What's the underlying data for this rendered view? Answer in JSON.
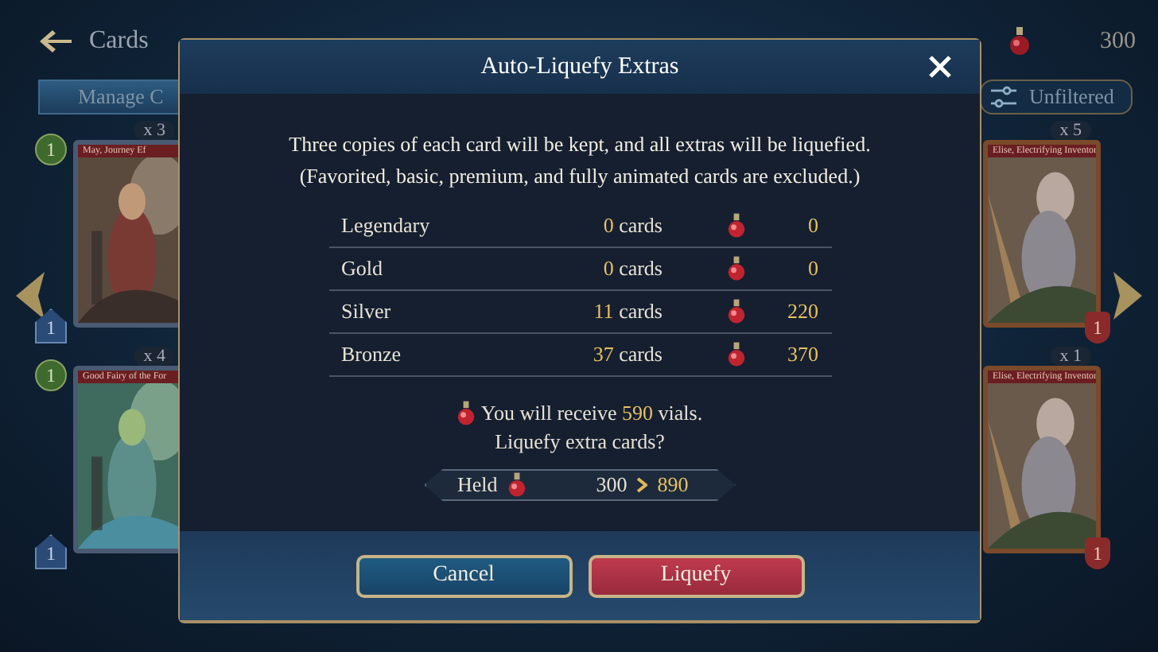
{
  "top_bar": {
    "title": "Cards",
    "vials": "300"
  },
  "manage_button": {
    "label": "Manage C"
  },
  "filter_button": {
    "label": "Unfiltered"
  },
  "left_cards": [
    {
      "count": "x 3",
      "title": "May, Journey Ef",
      "cost": "1",
      "gem": "1"
    },
    {
      "count": "x 4",
      "title": "Good Fairy of the For",
      "cost": "1",
      "gem": "1"
    }
  ],
  "right_cards": [
    {
      "count": "x 5",
      "title": "Elise, Electrifying Inventor",
      "badge": "1"
    },
    {
      "count": "x 1",
      "title": "Elise, Electrifying Inventor",
      "badge": "1"
    }
  ],
  "dialog": {
    "title": "Auto-Liquefy Extras",
    "description": [
      "Three copies of each card will be kept, and all extras will be liquefied.",
      "(Favorited, basic, premium, and fully animated cards are excluded.)"
    ],
    "rows": [
      {
        "rarity": "Legendary",
        "count": "0",
        "unit": "cards",
        "vials": "0"
      },
      {
        "rarity": "Gold",
        "count": "0",
        "unit": "cards",
        "vials": "0"
      },
      {
        "rarity": "Silver",
        "count": "11",
        "unit": "cards",
        "vials": "220"
      },
      {
        "rarity": "Bronze",
        "count": "37",
        "unit": "cards",
        "vials": "370"
      }
    ],
    "summary": {
      "prefix": "You will receive",
      "amount": "590",
      "suffix": "vials."
    },
    "question": "Liquefy extra cards?",
    "held": {
      "label": "Held",
      "from": "300",
      "to": "890"
    },
    "buttons": [
      {
        "label": "Cancel",
        "kind": "secondary"
      },
      {
        "label": "Liquefy",
        "kind": "primary"
      }
    ]
  }
}
